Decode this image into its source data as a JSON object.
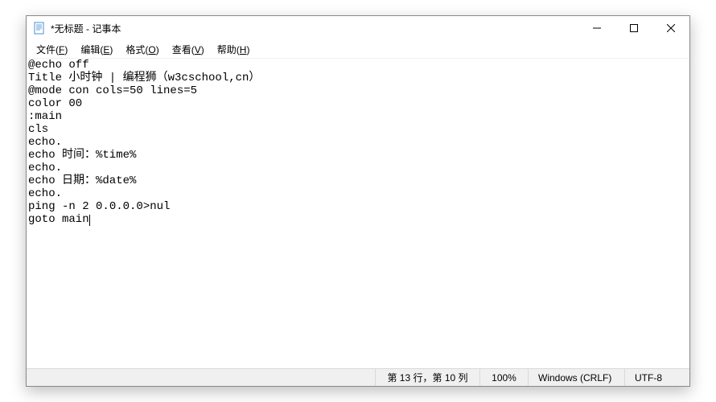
{
  "window": {
    "title": "*无标题 - 记事本"
  },
  "menu": {
    "file": {
      "label": "文件",
      "accel": "F"
    },
    "edit": {
      "label": "编辑",
      "accel": "E"
    },
    "format": {
      "label": "格式",
      "accel": "O"
    },
    "view": {
      "label": "查看",
      "accel": "V"
    },
    "help": {
      "label": "帮助",
      "accel": "H"
    }
  },
  "editor": {
    "lines": [
      "@echo off",
      "Title 小时钟 | 编程狮（w3cschool,cn）",
      "@mode con cols=50 lines=5",
      "color 00",
      ":main",
      "cls",
      "echo.",
      "echo 时间：%time%",
      "echo.",
      "echo 日期：%date%",
      "echo.",
      "ping -n 2 0.0.0.0>nul",
      "goto main"
    ]
  },
  "status": {
    "cursor": "第 13 行，第 10 列",
    "zoom": "100%",
    "eol": "Windows (CRLF)",
    "encoding": "UTF-8"
  }
}
